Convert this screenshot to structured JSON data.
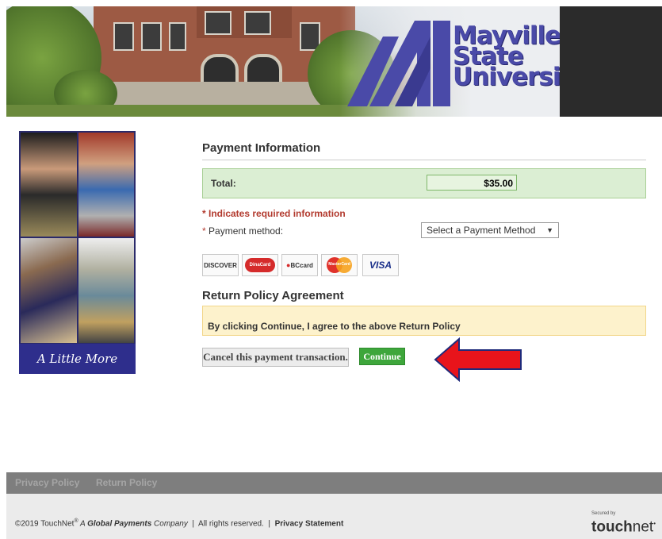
{
  "header": {
    "university_name_lines": [
      "Mayville",
      "State",
      "University"
    ],
    "brand_color": "#4a4aa8"
  },
  "sidebar_image": {
    "tagline": "A Little More"
  },
  "payment": {
    "title": "Payment Information",
    "total_label": "Total:",
    "total_value": "$35.00",
    "required_note": "* Indicates required information",
    "method_star": "* ",
    "method_label": "Payment method:",
    "method_selected": "Select a Payment Method",
    "cards": [
      "DISCOVER",
      "DinaCard",
      "BCcard",
      "MasterCard",
      "VISA"
    ]
  },
  "return_policy": {
    "title": "Return Policy Agreement",
    "agreement_text": "By clicking Continue, I agree to the above Return Policy"
  },
  "buttons": {
    "cancel": "Cancel this payment transaction.",
    "continue": "Continue"
  },
  "annotation": {
    "arrow_color": "#e8141b"
  },
  "footer_nav": {
    "privacy_policy": "Privacy Policy",
    "return_policy": "Return Policy"
  },
  "footer": {
    "copyright_prefix": "©2019 TouchNet",
    "registered": "®",
    "company_a": " A ",
    "company_name": "Global Payments",
    "company_suffix": " Company",
    "separator": "|",
    "rights": "All rights reserved.",
    "privacy_statement": "Privacy Statement",
    "secured_by": "Secured by",
    "touchnet_bold": "touch",
    "touchnet_light": "net"
  }
}
